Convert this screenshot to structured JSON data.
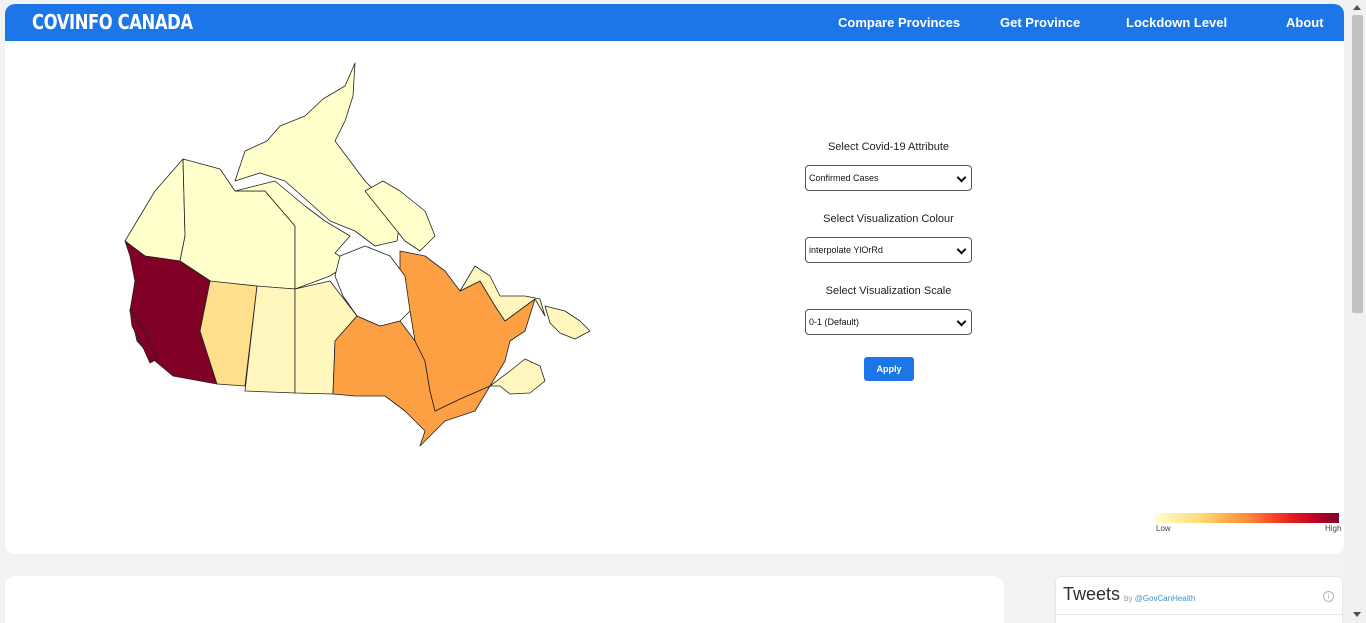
{
  "navbar": {
    "brand": "COVINFO CANADA",
    "links": [
      "Compare Provinces",
      "Get Province",
      "Lockdown Level",
      "About"
    ]
  },
  "controls": {
    "attribute_label": "Select Covid-19 Attribute",
    "attribute_value": "Confirmed Cases",
    "colour_label": "Select Visualization Colour",
    "colour_value": "interpolate YlOrRd",
    "scale_label": "Select Visualization Scale",
    "scale_value": "0-1 (Default)",
    "apply_label": "Apply"
  },
  "legend": {
    "low": "Low",
    "high": "High",
    "colors": [
      "#ffffcc",
      "#fed976",
      "#fd8d3c",
      "#e31a1c",
      "#800026"
    ]
  },
  "map": {
    "colors": {
      "british_columbia": "#800026",
      "alberta": "#fedf8b",
      "saskatchewan": "#fff6be",
      "manitoba": "#fff7bc",
      "ontario": "#fd9f43",
      "quebec": "#fd9f43",
      "atlantic": "#fff6be",
      "north": "#ffffcc"
    }
  },
  "tweets": {
    "title": "Tweets",
    "by": "by",
    "handle": "@GovCanHealth"
  },
  "icons": {
    "info": "info-icon",
    "dropdown": "chevron-down-icon"
  }
}
